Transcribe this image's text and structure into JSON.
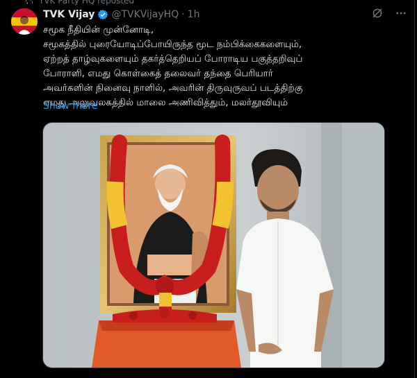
{
  "repost_banner": {
    "text": "TVK Party HQ reposted"
  },
  "tweet": {
    "display_name": "TVK Vijay",
    "handle": "@TVKVijayHQ",
    "separator": "·",
    "time": "1h",
    "text_lines": [
      "சமூக நீதியின் முன்னோடி,",
      "சமூகத்தில் புரையோடிப்போயிருந்த மூட நம்பிக்கைகளையும்,",
      "ஏற்றத் தாழ்வுகளையும் தகர்த்தெறியப் போராடிய பகுத்தறிவுப்",
      "போராளி, எமது கொள்கைத் தலைவர் தந்தை பெரியார்",
      "அவர்களின் நினைவு நாளில், அவரின் திருவுருவப் படத்திற்கு",
      "எமது அலுவலகத்தில் மாலை அணிவித்தும், மலர்தூவியும்"
    ],
    "show_more": "Show more"
  },
  "icons": {
    "repost": "repost-icon",
    "verified": "verified-badge-icon",
    "grok": "grok-icon",
    "more": "more-options-icon"
  },
  "colors": {
    "background": "#000000",
    "text": "#e7e9ea",
    "secondary": "#71767b",
    "link": "#1d9bf0",
    "verified": "#1d9bf0"
  }
}
